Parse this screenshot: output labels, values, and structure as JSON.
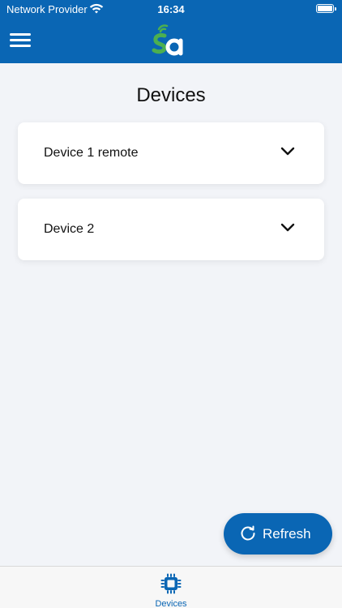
{
  "status_bar": {
    "carrier": "Network Provider",
    "time": "16:34"
  },
  "header": {
    "menu_icon": "hamburger-menu-icon",
    "logo": "sa-logo"
  },
  "page": {
    "title": "Devices"
  },
  "devices": [
    {
      "label": "Device 1 remote",
      "icon": "chevron-down-icon"
    },
    {
      "label": "Device 2",
      "icon": "chevron-down-icon"
    }
  ],
  "refresh_button": {
    "label": "Refresh",
    "icon": "refresh-icon"
  },
  "tab_bar": {
    "tabs": [
      {
        "label": "Devices",
        "icon": "chip-icon",
        "active": true
      }
    ]
  },
  "colors": {
    "primary": "#0a66b4",
    "logo_green": "#4caf50",
    "background": "#f2f4f8"
  }
}
